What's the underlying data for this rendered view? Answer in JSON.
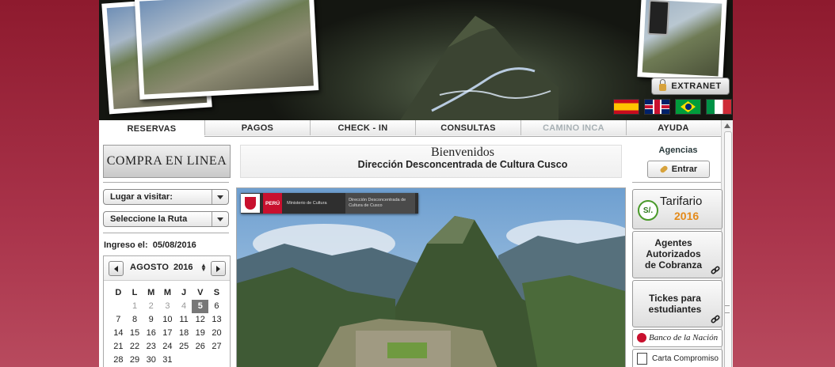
{
  "header": {
    "extranet_label": "EXTRANET",
    "languages": [
      "es",
      "en",
      "pt",
      "it"
    ]
  },
  "nav": {
    "tabs": [
      {
        "label": "RESERVAS",
        "state": "active"
      },
      {
        "label": "PAGOS",
        "state": "normal"
      },
      {
        "label": "CHECK - IN",
        "state": "normal"
      },
      {
        "label": "CONSULTAS",
        "state": "normal"
      },
      {
        "label": "CAMINO INCA",
        "state": "disabled"
      },
      {
        "label": "AYUDA",
        "state": "normal"
      }
    ]
  },
  "left": {
    "banner": "COMPRA EN LINEA",
    "place_select": "Lugar a visitar:",
    "route_select": "Seleccione la Ruta",
    "ingreso_label": "Ingreso el:",
    "ingreso_date": "05/08/2016"
  },
  "calendar": {
    "month": "AGOSTO",
    "year": "2016",
    "weekdays": [
      "D",
      "L",
      "M",
      "M",
      "J",
      "V",
      "S"
    ],
    "weeks": [
      [
        "",
        "1",
        "2",
        "3",
        "4",
        "5",
        "6"
      ],
      [
        "7",
        "8",
        "9",
        "10",
        "11",
        "12",
        "13"
      ],
      [
        "14",
        "15",
        "16",
        "17",
        "18",
        "19",
        "20"
      ],
      [
        "21",
        "22",
        "23",
        "24",
        "25",
        "26",
        "27"
      ],
      [
        "28",
        "29",
        "30",
        "31",
        "",
        "",
        ""
      ]
    ],
    "past_days": [
      "1",
      "2",
      "3",
      "4"
    ],
    "today": "5"
  },
  "center": {
    "welcome_title": "Bienvenidos",
    "welcome_subtitle": "Dirección Desconcentrada de Cultura Cusco",
    "gov_country": "PERÚ",
    "gov_ministry": "Ministerio de Cultura",
    "gov_direction": "Dirección Desconcentrada de Cultura de Cusco"
  },
  "right": {
    "agencias_title": "Agencias",
    "entrar_label": "Entrar",
    "tarifario_coin": "S/.",
    "tarifario_title": "Tarifario",
    "tarifario_year": "2016",
    "agentes_label": "Agentes Autorizados de Cobranza",
    "tickets_label": "Tickes para estudiantes",
    "bank_label": "Banco de la Nación",
    "carta_label": "Carta Compromiso"
  },
  "colors": {
    "background": "#a32a42",
    "accent_orange": "#e48a1a",
    "green": "#4a9a2a",
    "peru_red": "#c8102e"
  }
}
